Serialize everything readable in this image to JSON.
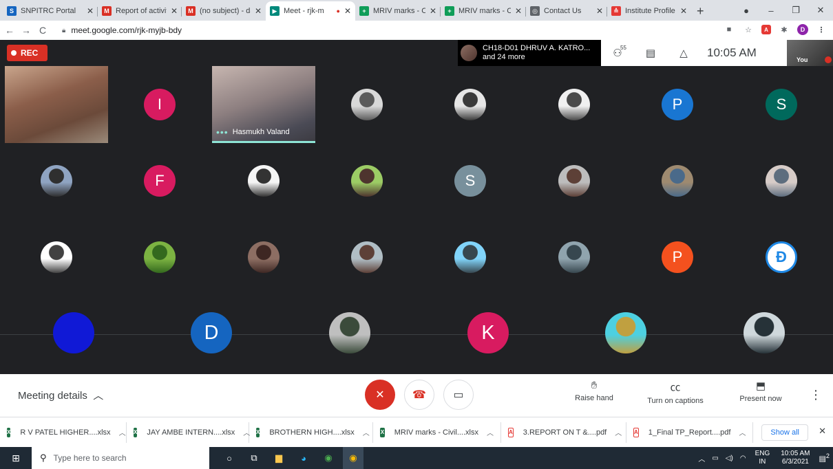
{
  "tabs": [
    {
      "title": "SNPITRC Portal",
      "icon": "snpitrc-favicon",
      "glyph": "S",
      "color": "#1565c0",
      "active": false
    },
    {
      "title": "Report of activity",
      "icon": "gmail-favicon",
      "glyph": "M",
      "color": "#d93025",
      "active": false
    },
    {
      "title": "(no subject) - dar",
      "icon": "gmail-favicon",
      "glyph": "M",
      "color": "#d93025",
      "active": false
    },
    {
      "title": "Meet - rjk-m",
      "icon": "meet-favicon",
      "glyph": "▶",
      "color": "#00897b",
      "active": true
    },
    {
      "title": "MRIV marks - Civ",
      "icon": "sheets-favicon",
      "glyph": "+",
      "color": "#0f9d58",
      "active": false
    },
    {
      "title": "MRIV marks - Civ",
      "icon": "sheets-favicon",
      "glyph": "+",
      "color": "#0f9d58",
      "active": false
    },
    {
      "title": "Contact Us",
      "icon": "globe-favicon",
      "glyph": "◎",
      "color": "#5f6368",
      "active": false
    },
    {
      "title": "Institute Profile",
      "icon": "institute-favicon",
      "glyph": "≙",
      "color": "#e53935",
      "active": false
    }
  ],
  "new_tab": "+",
  "address": {
    "url": "meet.google.com/rjk-myjb-bdy"
  },
  "rec_label": "REC",
  "speaker": {
    "name": "CH18-D01 DHRUV A. KATRO...",
    "more": "and 24 more"
  },
  "participant_count": "55",
  "time": "10:05 AM",
  "you_label": "You",
  "video_tiles": [
    {
      "name": "",
      "bg": "linear-gradient(160deg,#c9a58c 0%,#8b5e4a 40%,#6b4a3a 70%,#9a8a7a 100%)"
    },
    {
      "name": "Hasmukh Valand",
      "bg": "linear-gradient(160deg,#c7b6b0 0%,#8d7f80 45%,#4a4a55 80%,#3b3a40 100%)"
    }
  ],
  "grid": [
    {
      "letter": "I",
      "color": "#d81b60",
      "photo": false
    },
    {
      "photo": true,
      "g": "#d9d9d9,#5a5a5a"
    },
    {
      "photo": true,
      "g": "#e6e6e6,#3a3a3a"
    },
    {
      "photo": true,
      "g": "#f0f0f0,#4a4a4a"
    },
    {
      "letter": "P",
      "color": "#1976d2",
      "photo": false
    },
    {
      "letter": "S",
      "color": "#00695c",
      "photo": false
    },
    {
      "photo": true,
      "g": "#8fa4c2,#2f2f2f"
    },
    {
      "letter": "F",
      "color": "#d81b60",
      "photo": false
    },
    {
      "photo": true,
      "g": "#f5f5f5,#333333"
    },
    {
      "photo": true,
      "g": "#9ccc65,#4e342e"
    },
    {
      "letter": "S",
      "color": "#78909c",
      "photo": false
    },
    {
      "photo": true,
      "g": "#bdbdbd,#5d4037"
    },
    {
      "photo": true,
      "g": "#9e8a70,#4a6a8a"
    },
    {
      "photo": true,
      "g": "#d7ccc8,#5d6d7e"
    },
    {
      "photo": true,
      "g": "#ffffff,#424242"
    },
    {
      "photo": true,
      "g": "#7cb342,#33691e"
    },
    {
      "photo": true,
      "g": "#8d6e63,#3e2723"
    },
    {
      "photo": true,
      "g": "#b0bec5,#5d4037"
    },
    {
      "photo": true,
      "g": "#81d4fa,#37474f"
    },
    {
      "photo": true,
      "g": "#90a4ae,#37474f"
    },
    {
      "letter": "P",
      "color": "#f4511e",
      "photo": false
    },
    {
      "photo": true,
      "g": "#ffffff,#1e88e5",
      "logo": true
    }
  ],
  "row4": [
    {
      "photo": false,
      "letter": "",
      "color": "#1019d6"
    },
    {
      "photo": false,
      "letter": "D",
      "color": "#1565c0"
    },
    {
      "photo": true,
      "g": "#bfbfbf,#3b4b3b"
    },
    {
      "photo": false,
      "letter": "K",
      "color": "#d81b60"
    },
    {
      "photo": true,
      "g": "#4dd0e1,#c0a040"
    },
    {
      "photo": true,
      "g": "#cfd8dc,#263238"
    }
  ],
  "controls": {
    "meeting_details": "Meeting details",
    "raise_hand": "Raise hand",
    "captions": "Turn on captions",
    "present": "Present now"
  },
  "downloads": [
    {
      "name": "R V PATEL HIGHER....xlsx",
      "type": "xlsx"
    },
    {
      "name": "JAY AMBE INTERN....xlsx",
      "type": "xlsx"
    },
    {
      "name": "BROTHERN HIGH....xlsx",
      "type": "xlsx"
    },
    {
      "name": "MRIV marks - Civil....xlsx",
      "type": "xlsx"
    },
    {
      "name": "3.REPORT ON T &....pdf",
      "type": "pdf"
    },
    {
      "name": "1_Final TP_Report....pdf",
      "type": "pdf"
    }
  ],
  "show_all": "Show all",
  "taskbar": {
    "search_placeholder": "Type here to search",
    "lang": "ENG",
    "region": "IN",
    "time": "10:05 AM",
    "date": "6/3/2021",
    "notif": "2"
  }
}
